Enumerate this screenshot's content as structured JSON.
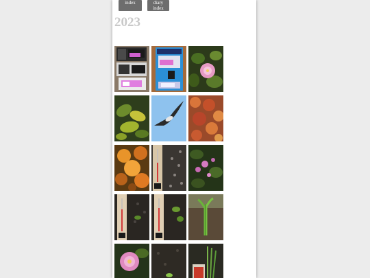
{
  "nav": {
    "index_label": "index",
    "diary_index_label": "diary index"
  },
  "year_heading": "2023",
  "thumbnails": [
    {
      "name": "thumb-memory-card-packages",
      "subject": "sd card packages on box"
    },
    {
      "name": "thumb-kioxia-microsd-package",
      "subject": "microSD card blister pack"
    },
    {
      "name": "thumb-pink-camellia",
      "subject": "pink camellia flower"
    },
    {
      "name": "thumb-green-leaves",
      "subject": "green and yellow leaves"
    },
    {
      "name": "thumb-bird-in-sky",
      "subject": "bird flying in blue sky"
    },
    {
      "name": "thumb-autumn-leaves-red",
      "subject": "red autumn maple leaves"
    },
    {
      "name": "thumb-autumn-leaves-orange",
      "subject": "orange autumn maple leaves"
    },
    {
      "name": "thumb-thermometer-gravel",
      "subject": "thermometer on gravel"
    },
    {
      "name": "thumb-pink-flowers-shrub",
      "subject": "pink flowers on shrub"
    },
    {
      "name": "thumb-thermometer-soil-1",
      "subject": "thermometer in soil"
    },
    {
      "name": "thumb-thermometer-soil-2",
      "subject": "thermometer in soil with seedling"
    },
    {
      "name": "thumb-green-sprouts",
      "subject": "green sprouts in soil"
    },
    {
      "name": "thumb-pink-camellia-2",
      "subject": "pink camellia flower"
    },
    {
      "name": "thumb-seedling-soil",
      "subject": "seedling in soil"
    },
    {
      "name": "thumb-seed-packet",
      "subject": "seed packet with sprouts"
    }
  ]
}
